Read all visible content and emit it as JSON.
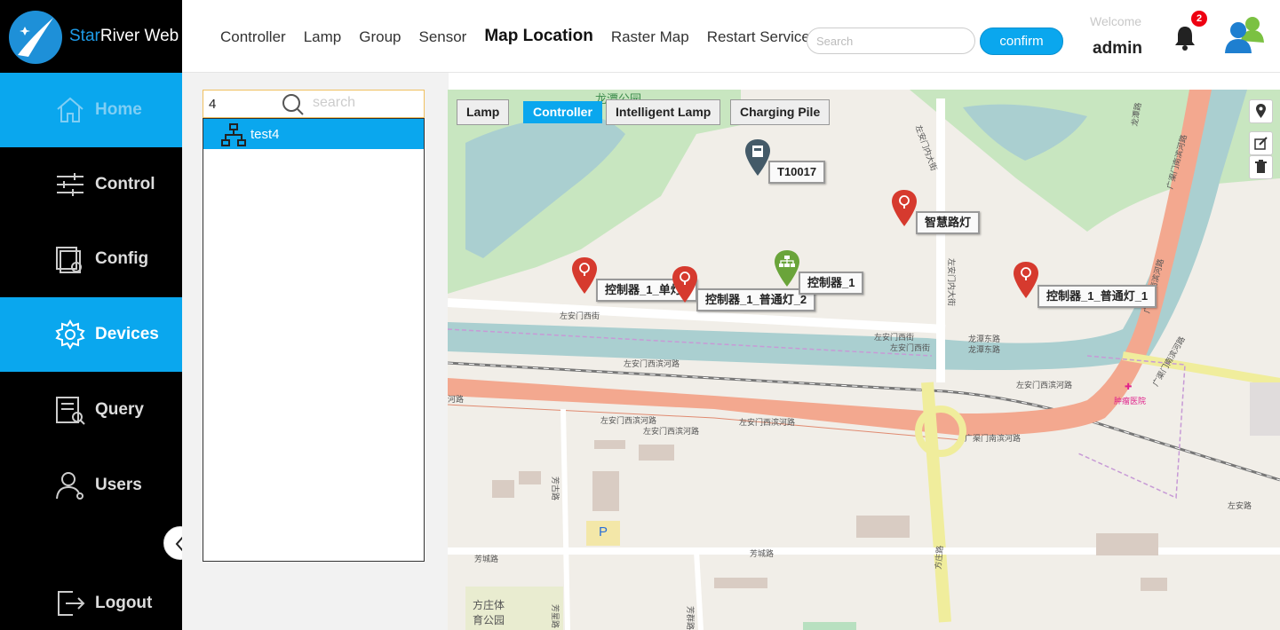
{
  "app": {
    "title_part1": "Star",
    "title_part2": "River Web"
  },
  "nav": {
    "items": [
      "Controller",
      "Lamp",
      "Group",
      "Sensor",
      "Map Location",
      "Raster Map",
      "Restart Service"
    ],
    "active": "Map Location"
  },
  "header": {
    "search_placeholder": "Search",
    "confirm_label": "confirm",
    "welcome": "Welcome",
    "user": "admin",
    "notification_count": "2"
  },
  "sidebar": {
    "items": [
      {
        "label": "Home",
        "icon": "home-icon"
      },
      {
        "label": "Control",
        "icon": "sliders-icon"
      },
      {
        "label": "Config",
        "icon": "config-icon"
      },
      {
        "label": "Devices",
        "icon": "gear-icon"
      },
      {
        "label": "Query",
        "icon": "query-icon"
      },
      {
        "label": "Users",
        "icon": "user-icon"
      },
      {
        "label": "Logout",
        "icon": "logout-icon"
      }
    ],
    "active": "Devices"
  },
  "tree": {
    "search_value": "4",
    "search_placeholder": "search",
    "nodes": [
      {
        "label": "test4",
        "icon": "hierarchy-icon"
      }
    ]
  },
  "map": {
    "type_buttons": [
      "Lamp",
      "Controller",
      "Intelligent Lamp",
      "Charging Pile"
    ],
    "active_type": "Controller",
    "markers": [
      {
        "label": "T10017",
        "kind": "charging-pile"
      },
      {
        "label": "智慧路灯",
        "kind": "lamp"
      },
      {
        "label": "控制器_1_单灯_",
        "kind": "lamp"
      },
      {
        "label": "控制器_1_普通灯_2",
        "kind": "lamp"
      },
      {
        "label": "控制器_1",
        "kind": "controller"
      },
      {
        "label": "控制器_1_普通灯_1",
        "kind": "lamp"
      }
    ],
    "street_labels": {
      "park_top": "龙潭公园",
      "zuoanmen_w": "左安门西街",
      "zuoanmen_w2": "左安门西街",
      "zuoanmen_w3": "左安门西街",
      "zuoanmen_inner1": "左安门内大街",
      "zuoanmen_inner2": "左安门内大街",
      "longtan_e": "龙潭东路",
      "longtan_e2": "龙潭东路",
      "binhe1": "左安门西滨河路",
      "binhe2": "左安门西滨河路",
      "binhe3": "左安门西滨河路",
      "binhe4": "左安门西滨河路",
      "binhe5": "左安门西滨河路",
      "guangqu1": "广渠门南滨河路",
      "guangqu2": "广渠门南滨河路",
      "guangqu3": "广渠门南滨河路",
      "guangqu4": "广渠门南滨河路",
      "longtan_road": "龙潭路",
      "hospital": "肿瘤医院",
      "fanggu": "芳古路",
      "fangcheng": "芳城路",
      "fangcheng2": "芳城路",
      "fangzhuang": "方庄路",
      "fangxing": "芳星路",
      "fangqun": "芳群路",
      "zuoan_road": "左安路",
      "binhe_left": "河路",
      "park_bottom1": "方庄体",
      "park_bottom2": "育公园",
      "parking": "P"
    }
  }
}
